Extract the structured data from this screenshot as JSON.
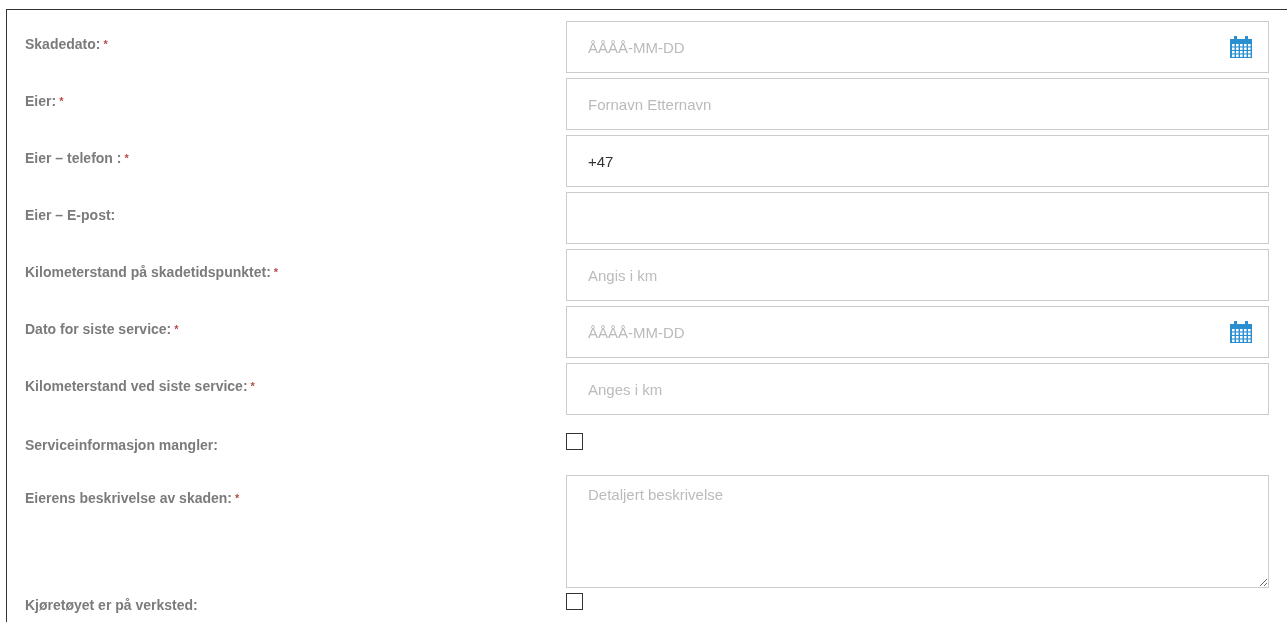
{
  "fields": [
    {
      "kind": "date",
      "label": "Skadedato:",
      "required_mark": "*",
      "placeholder": "ÅÅÅÅ-MM-DD"
    },
    {
      "kind": "text",
      "label": "Eier:",
      "required_mark": "*",
      "placeholder": "Fornavn Etternavn"
    },
    {
      "kind": "text",
      "label": "Eier – telefon :",
      "required_mark": "*",
      "value": "+47"
    },
    {
      "kind": "text",
      "label": "Eier – E-post:"
    },
    {
      "kind": "text",
      "label": "Kilometerstand på skadetidspunktet:",
      "required_mark": "*",
      "placeholder": "Angis i km"
    },
    {
      "kind": "date",
      "label": "Dato for siste service:",
      "required_mark": "*",
      "placeholder": "ÅÅÅÅ-MM-DD"
    },
    {
      "kind": "text",
      "label": "Kilometerstand ved siste service:",
      "required_mark": "*",
      "placeholder": "Anges i km"
    },
    {
      "kind": "checkbox",
      "label": "Serviceinformasjon mangler:",
      "checked": false
    },
    {
      "kind": "textarea",
      "label": "Eierens beskrivelse av skaden:",
      "required_mark": "*",
      "placeholder": "Detaljert beskrivelse"
    },
    {
      "kind": "checkbox",
      "label": "Kjøretøyet er på verksted:",
      "checked": false
    }
  ]
}
